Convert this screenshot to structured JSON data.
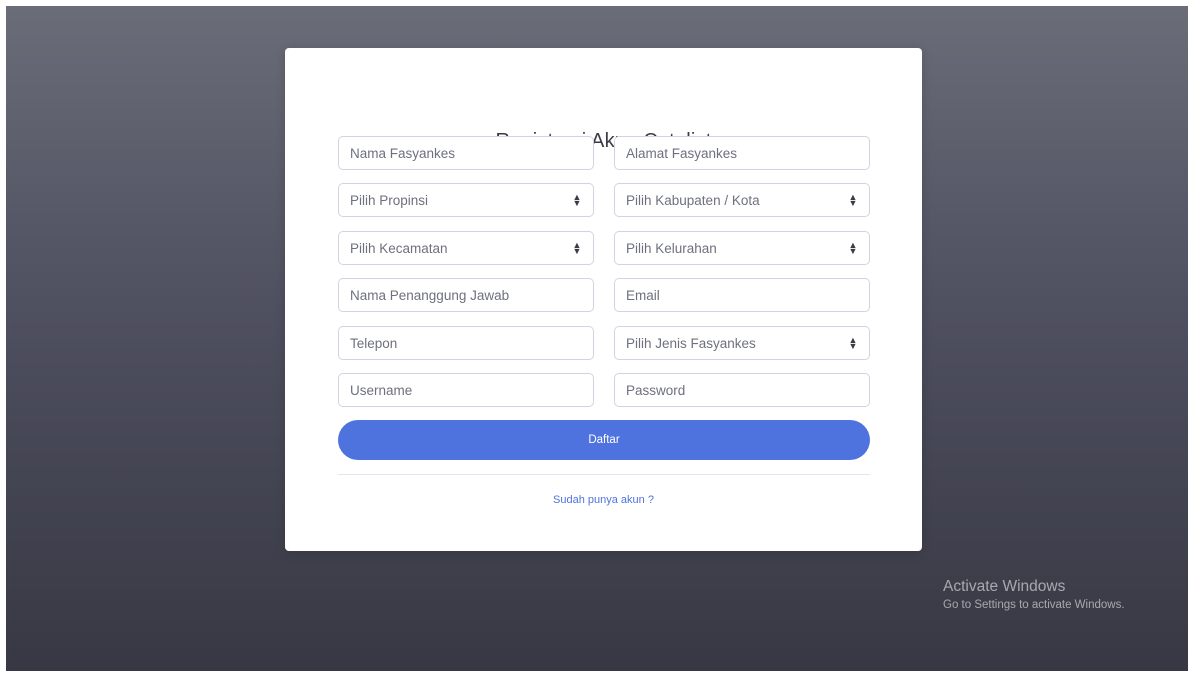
{
  "form": {
    "title": "Registrasi Akun Catalist",
    "fields": {
      "nama_fasyankes": "Nama Fasyankes",
      "alamat_fasyankes": "Alamat Fasyankes",
      "propinsi": "Pilih Propinsi",
      "kabupaten_kota": "Pilih Kabupaten / Kota",
      "kecamatan": "Pilih Kecamatan",
      "kelurahan": "Pilih Kelurahan",
      "penanggung_jawab": "Nama Penanggung Jawab",
      "email": "Email",
      "telepon": "Telepon",
      "jenis_fasyankes": "Pilih Jenis Fasyankes",
      "username": "Username",
      "password": "Password"
    },
    "submit_label": "Daftar",
    "login_link": "Sudah punya akun ?"
  },
  "watermark": {
    "title": "Activate Windows",
    "subtitle": "Go to Settings to activate Windows."
  },
  "colors": {
    "primary": "#4e73df",
    "background_top": "#6a6c78",
    "background_bottom": "#373843"
  }
}
